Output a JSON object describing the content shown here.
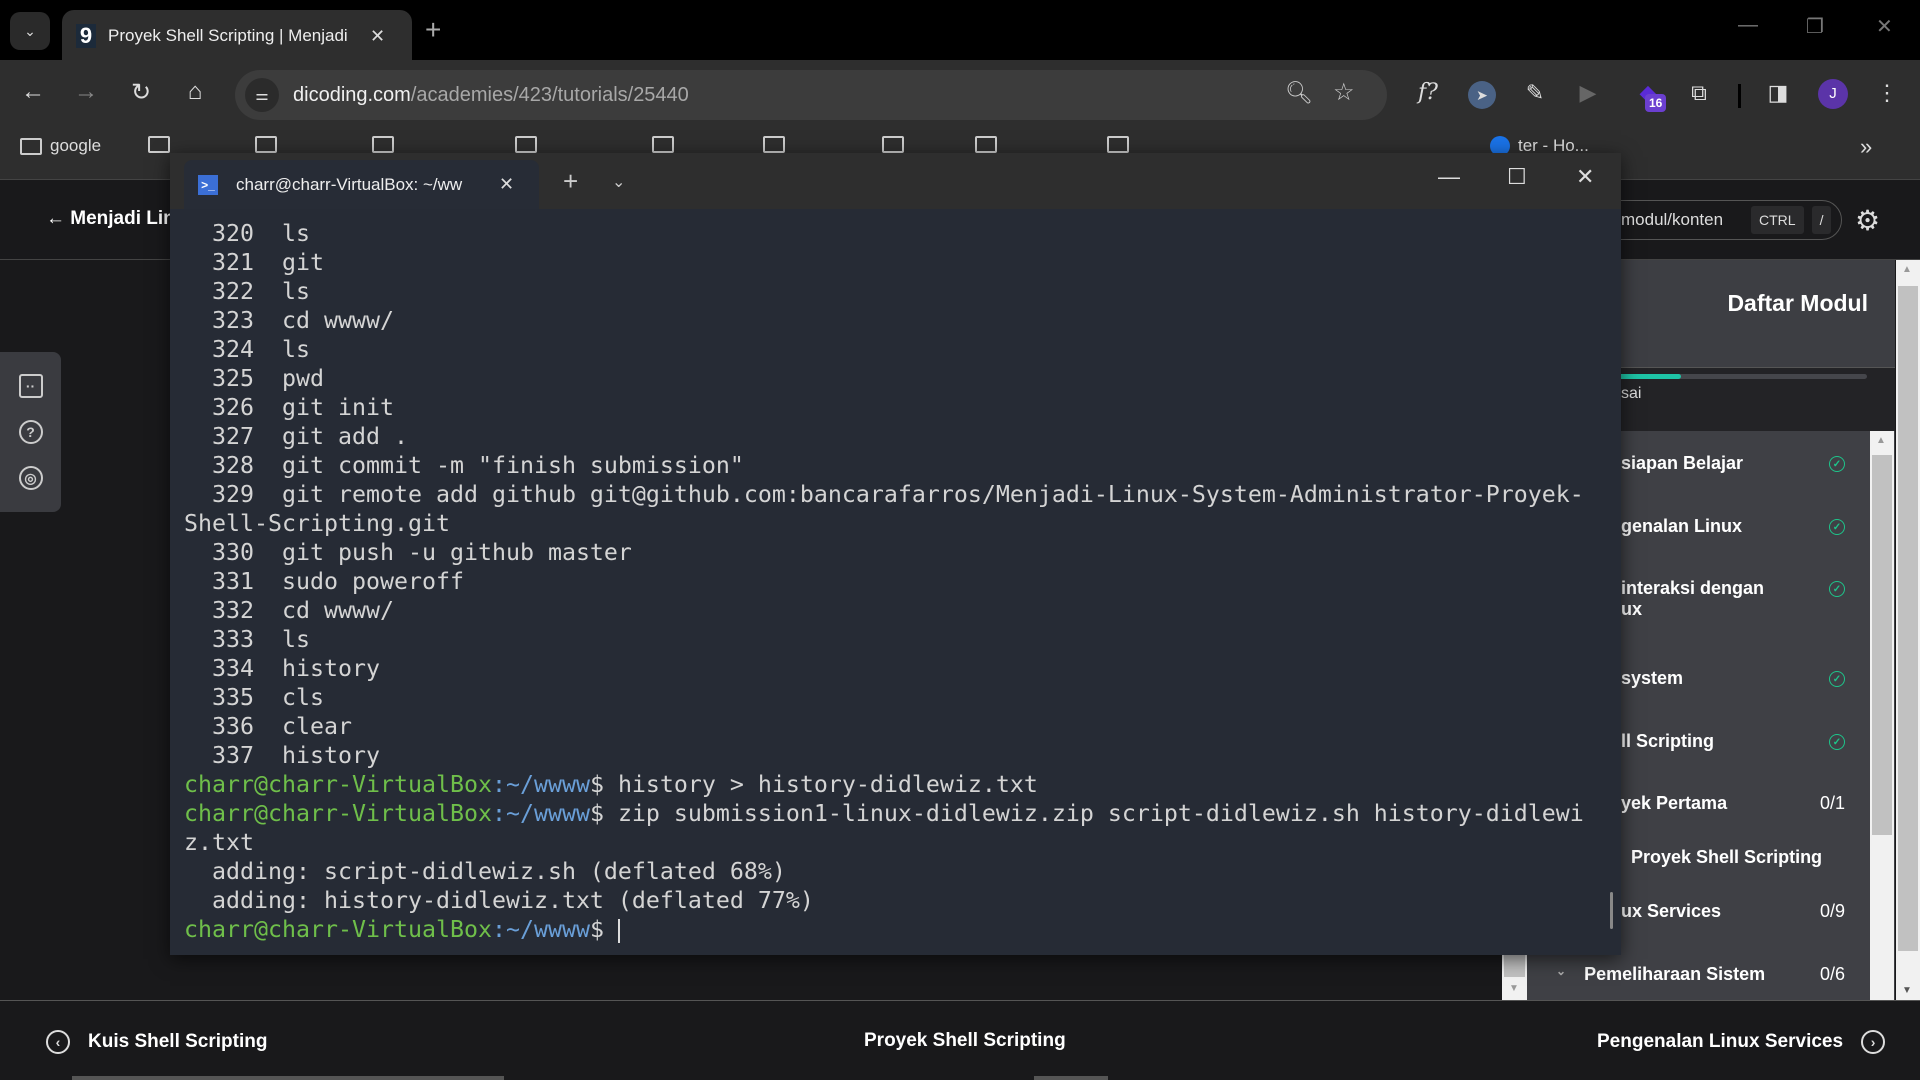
{
  "browser": {
    "tab_title": "Proyek Shell Scripting | Menjadi",
    "tab_favicon": "9",
    "url_host": "dicoding.com",
    "url_path": "/academies/423/tutorials/25440",
    "extension_badge": "16",
    "profile_initial": "J",
    "bookmarks": [
      {
        "label": "google",
        "icon": "folder-icon"
      },
      {
        "label": "",
        "icon": "folder-icon"
      },
      {
        "label": "",
        "icon": "folder-icon"
      },
      {
        "label": "",
        "icon": "folder-icon"
      },
      {
        "label": "",
        "icon": "folder-icon"
      },
      {
        "label": "",
        "icon": "folder-icon"
      },
      {
        "label": "",
        "icon": "folder-icon"
      },
      {
        "label": "",
        "icon": "folder-icon"
      },
      {
        "label": "",
        "icon": "folder-icon"
      },
      {
        "label": "",
        "icon": "folder-icon"
      },
      {
        "label": "ter - Ho...",
        "icon": "site-icon"
      }
    ]
  },
  "page": {
    "back_label": "Menjadi Linux System Administrator",
    "search_placeholder": "modul/konten",
    "shortcut_keys": [
      "CTRL",
      "/"
    ],
    "modul_title": "Daftar Modul",
    "progress_text": "sai",
    "progress_fraction": 0.33,
    "modules": [
      {
        "label": "siapan Belajar",
        "done": true,
        "count": ""
      },
      {
        "label": "genalan Linux",
        "done": true,
        "count": ""
      },
      {
        "label": "interaksi dengan ux",
        "done": true,
        "count": ""
      },
      {
        "label": "system",
        "done": true,
        "count": ""
      },
      {
        "label": "ll Scripting",
        "done": true,
        "count": ""
      },
      {
        "label": "yek Pertama",
        "done": false,
        "count": "0/1"
      },
      {
        "label": "Proyek Shell Scripting",
        "done": false,
        "count": "",
        "sub": true
      },
      {
        "label": "ux Services",
        "done": false,
        "count": "0/9"
      },
      {
        "label": "Pemeliharaan Sistem",
        "done": false,
        "count": "0/6",
        "chevron": true
      }
    ],
    "bottom_nav": {
      "prev": "Kuis Shell Scripting",
      "current": "Proyek Shell Scripting",
      "next": "Pengenalan Linux Services"
    },
    "accent_color": "#1ec4a6"
  },
  "terminal": {
    "tab_title": "charr@charr-VirtualBox: ~/ww",
    "prompt_user": "charr@charr-VirtualBox",
    "prompt_path": ":~/wwww",
    "prompt_symbol": "$ ",
    "lines": [
      {
        "text": "  320  ls"
      },
      {
        "text": "  321  git"
      },
      {
        "text": "  322  ls"
      },
      {
        "text": "  323  cd wwww/"
      },
      {
        "text": "  324  ls"
      },
      {
        "text": "  325  pwd"
      },
      {
        "text": "  326  git init"
      },
      {
        "text": "  327  git add ."
      },
      {
        "text": "  328  git commit -m \"finish submission\""
      },
      {
        "text": "  329  git remote add github git@github.com:bancarafarros/Menjadi-Linux-System-Administrator-Proyek-Shell-Scripting.git"
      },
      {
        "text": "  330  git push -u github master"
      },
      {
        "text": "  331  sudo poweroff"
      },
      {
        "text": "  332  cd wwww/"
      },
      {
        "text": "  333  ls"
      },
      {
        "text": "  334  history"
      },
      {
        "text": "  335  cls"
      },
      {
        "text": "  336  clear"
      },
      {
        "text": "  337  history"
      },
      {
        "prompt": true,
        "text": "history > history-didlewiz.txt"
      },
      {
        "prompt": true,
        "text": "zip submission1-linux-didlewiz.zip script-didlewiz.sh history-didlewiz.txt"
      },
      {
        "text": "  adding: script-didlewiz.sh (deflated 68%)"
      },
      {
        "text": "  adding: history-didlewiz.txt (deflated 77%)"
      },
      {
        "prompt": true,
        "text": "",
        "cursor": true
      }
    ]
  }
}
